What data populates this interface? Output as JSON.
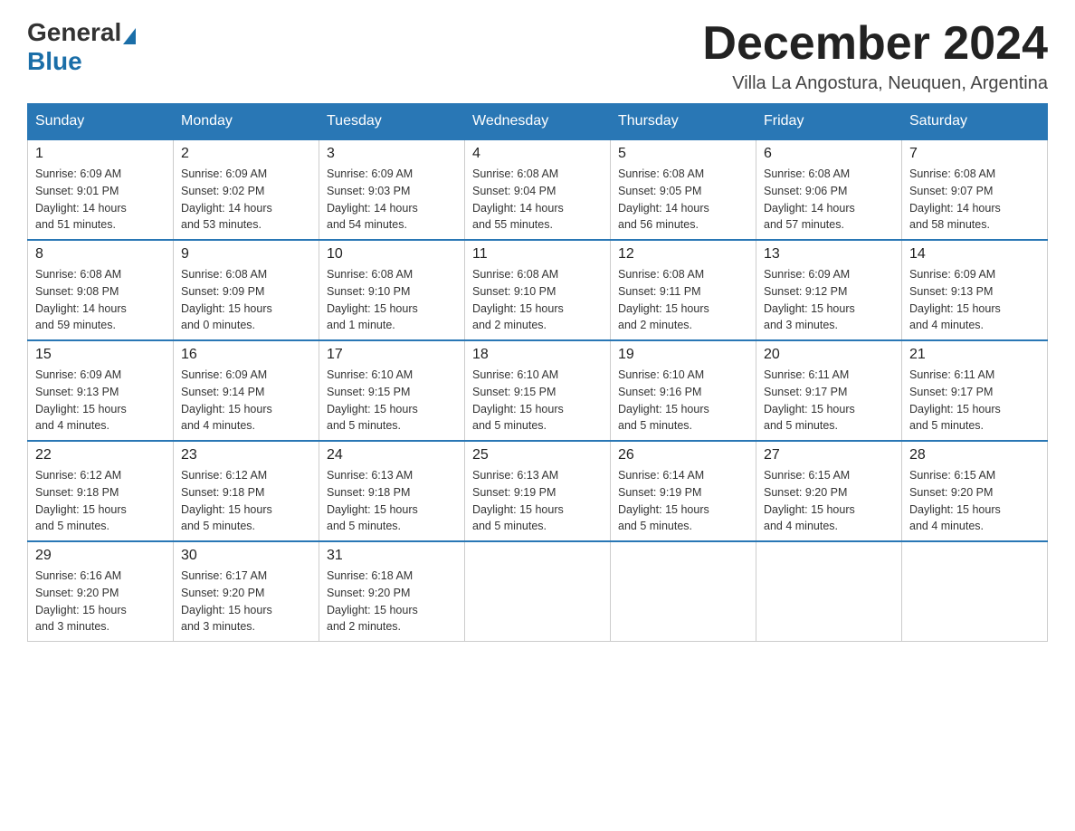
{
  "header": {
    "logo_general": "General",
    "logo_blue": "Blue",
    "month_title": "December 2024",
    "location": "Villa La Angostura, Neuquen, Argentina"
  },
  "weekdays": [
    "Sunday",
    "Monday",
    "Tuesday",
    "Wednesday",
    "Thursday",
    "Friday",
    "Saturday"
  ],
  "weeks": [
    [
      {
        "day": "1",
        "sunrise": "6:09 AM",
        "sunset": "9:01 PM",
        "daylight": "14 hours and 51 minutes."
      },
      {
        "day": "2",
        "sunrise": "6:09 AM",
        "sunset": "9:02 PM",
        "daylight": "14 hours and 53 minutes."
      },
      {
        "day": "3",
        "sunrise": "6:09 AM",
        "sunset": "9:03 PM",
        "daylight": "14 hours and 54 minutes."
      },
      {
        "day": "4",
        "sunrise": "6:08 AM",
        "sunset": "9:04 PM",
        "daylight": "14 hours and 55 minutes."
      },
      {
        "day": "5",
        "sunrise": "6:08 AM",
        "sunset": "9:05 PM",
        "daylight": "14 hours and 56 minutes."
      },
      {
        "day": "6",
        "sunrise": "6:08 AM",
        "sunset": "9:06 PM",
        "daylight": "14 hours and 57 minutes."
      },
      {
        "day": "7",
        "sunrise": "6:08 AM",
        "sunset": "9:07 PM",
        "daylight": "14 hours and 58 minutes."
      }
    ],
    [
      {
        "day": "8",
        "sunrise": "6:08 AM",
        "sunset": "9:08 PM",
        "daylight": "14 hours and 59 minutes."
      },
      {
        "day": "9",
        "sunrise": "6:08 AM",
        "sunset": "9:09 PM",
        "daylight": "15 hours and 0 minutes."
      },
      {
        "day": "10",
        "sunrise": "6:08 AM",
        "sunset": "9:10 PM",
        "daylight": "15 hours and 1 minute."
      },
      {
        "day": "11",
        "sunrise": "6:08 AM",
        "sunset": "9:10 PM",
        "daylight": "15 hours and 2 minutes."
      },
      {
        "day": "12",
        "sunrise": "6:08 AM",
        "sunset": "9:11 PM",
        "daylight": "15 hours and 2 minutes."
      },
      {
        "day": "13",
        "sunrise": "6:09 AM",
        "sunset": "9:12 PM",
        "daylight": "15 hours and 3 minutes."
      },
      {
        "day": "14",
        "sunrise": "6:09 AM",
        "sunset": "9:13 PM",
        "daylight": "15 hours and 4 minutes."
      }
    ],
    [
      {
        "day": "15",
        "sunrise": "6:09 AM",
        "sunset": "9:13 PM",
        "daylight": "15 hours and 4 minutes."
      },
      {
        "day": "16",
        "sunrise": "6:09 AM",
        "sunset": "9:14 PM",
        "daylight": "15 hours and 4 minutes."
      },
      {
        "day": "17",
        "sunrise": "6:10 AM",
        "sunset": "9:15 PM",
        "daylight": "15 hours and 5 minutes."
      },
      {
        "day": "18",
        "sunrise": "6:10 AM",
        "sunset": "9:15 PM",
        "daylight": "15 hours and 5 minutes."
      },
      {
        "day": "19",
        "sunrise": "6:10 AM",
        "sunset": "9:16 PM",
        "daylight": "15 hours and 5 minutes."
      },
      {
        "day": "20",
        "sunrise": "6:11 AM",
        "sunset": "9:17 PM",
        "daylight": "15 hours and 5 minutes."
      },
      {
        "day": "21",
        "sunrise": "6:11 AM",
        "sunset": "9:17 PM",
        "daylight": "15 hours and 5 minutes."
      }
    ],
    [
      {
        "day": "22",
        "sunrise": "6:12 AM",
        "sunset": "9:18 PM",
        "daylight": "15 hours and 5 minutes."
      },
      {
        "day": "23",
        "sunrise": "6:12 AM",
        "sunset": "9:18 PM",
        "daylight": "15 hours and 5 minutes."
      },
      {
        "day": "24",
        "sunrise": "6:13 AM",
        "sunset": "9:18 PM",
        "daylight": "15 hours and 5 minutes."
      },
      {
        "day": "25",
        "sunrise": "6:13 AM",
        "sunset": "9:19 PM",
        "daylight": "15 hours and 5 minutes."
      },
      {
        "day": "26",
        "sunrise": "6:14 AM",
        "sunset": "9:19 PM",
        "daylight": "15 hours and 5 minutes."
      },
      {
        "day": "27",
        "sunrise": "6:15 AM",
        "sunset": "9:20 PM",
        "daylight": "15 hours and 4 minutes."
      },
      {
        "day": "28",
        "sunrise": "6:15 AM",
        "sunset": "9:20 PM",
        "daylight": "15 hours and 4 minutes."
      }
    ],
    [
      {
        "day": "29",
        "sunrise": "6:16 AM",
        "sunset": "9:20 PM",
        "daylight": "15 hours and 3 minutes."
      },
      {
        "day": "30",
        "sunrise": "6:17 AM",
        "sunset": "9:20 PM",
        "daylight": "15 hours and 3 minutes."
      },
      {
        "day": "31",
        "sunrise": "6:18 AM",
        "sunset": "9:20 PM",
        "daylight": "15 hours and 2 minutes."
      },
      null,
      null,
      null,
      null
    ]
  ],
  "labels": {
    "sunrise": "Sunrise:",
    "sunset": "Sunset:",
    "daylight": "Daylight:"
  }
}
